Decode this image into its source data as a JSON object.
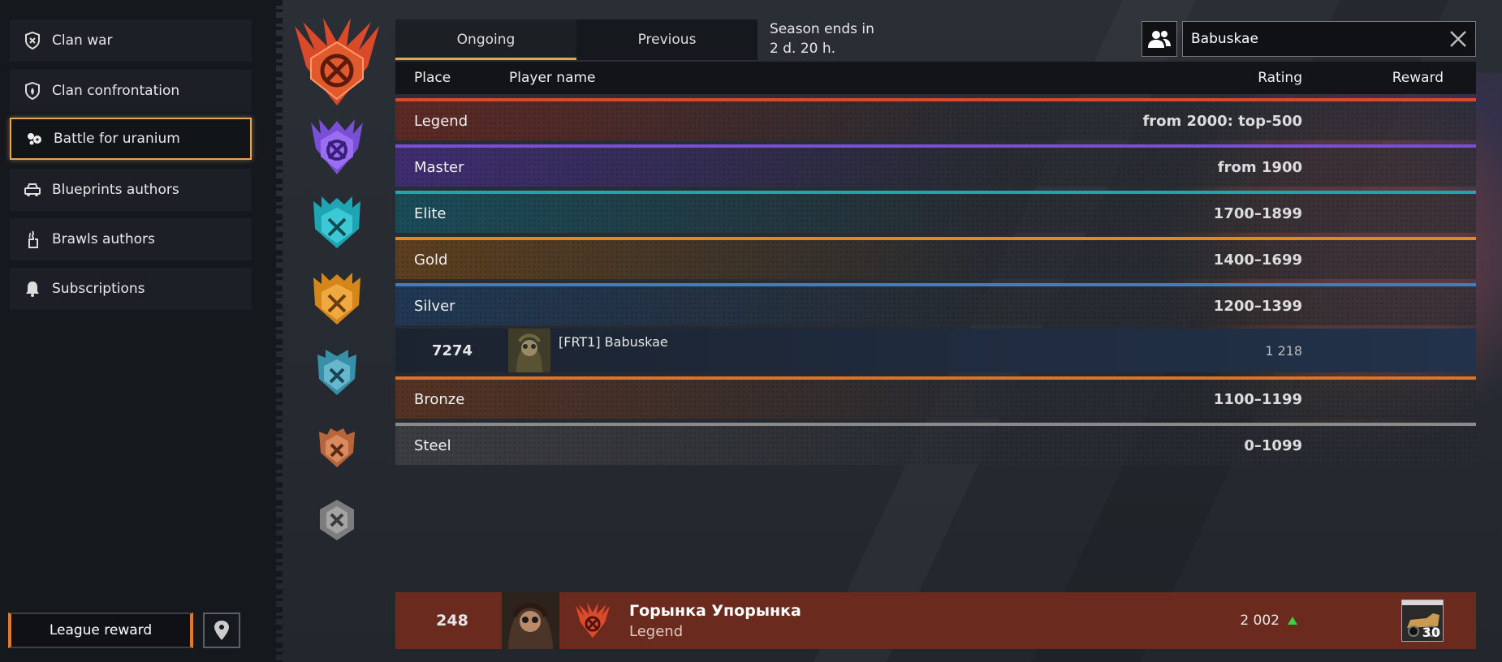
{
  "sidebar": {
    "items": [
      {
        "label": "Clan war",
        "icon": "clan-war-shield-icon"
      },
      {
        "label": "Clan confrontation",
        "icon": "clan-confrontation-shield-icon"
      },
      {
        "label": "Battle for uranium",
        "icon": "uranium-icon",
        "active": true
      },
      {
        "label": "Blueprints authors",
        "icon": "car-icon"
      },
      {
        "label": "Brawls authors",
        "icon": "fire-hand-icon"
      },
      {
        "label": "Subscriptions",
        "icon": "bell-icon"
      }
    ],
    "league_reward_label": "League reward"
  },
  "tabs": [
    {
      "label": "Ongoing",
      "active": true
    },
    {
      "label": "Previous",
      "active": false
    }
  ],
  "season": {
    "line1": "Season ends in",
    "line2": "2 d. 20 h."
  },
  "search": {
    "value": "Babuskae"
  },
  "table": {
    "headers": {
      "place": "Place",
      "player": "Player name",
      "rating": "Rating",
      "reward": "Reward"
    },
    "tiers": [
      {
        "name": "Legend",
        "range": "from 2000: top-500",
        "color": "#d9492a"
      },
      {
        "name": "Master",
        "range": "from 1900",
        "color": "#7a4fd8"
      },
      {
        "name": "Elite",
        "range": "1700–1899",
        "color": "#1fa4b4"
      },
      {
        "name": "Gold",
        "range": "1400–1699",
        "color": "#e08a1c"
      },
      {
        "name": "Silver",
        "range": "1200–1399",
        "color": "#3d7fc4"
      },
      {
        "name": "Bronze",
        "range": "1100–1199",
        "color": "#d9742a"
      },
      {
        "name": "Steel",
        "range": "0–1099",
        "color": "#8a8a8a"
      }
    ],
    "player_row": {
      "place": "7274",
      "name": "[FRT1] Babuskae",
      "rating": "1 218"
    }
  },
  "me": {
    "place": "248",
    "name": "Горынка Упорынка",
    "league": "Legend",
    "rating": "2 002",
    "reward_count": "30"
  },
  "colors": {
    "accent": "#e6a457",
    "legend_row": "#6a2a1e",
    "up_arrow": "#3bd13b"
  }
}
